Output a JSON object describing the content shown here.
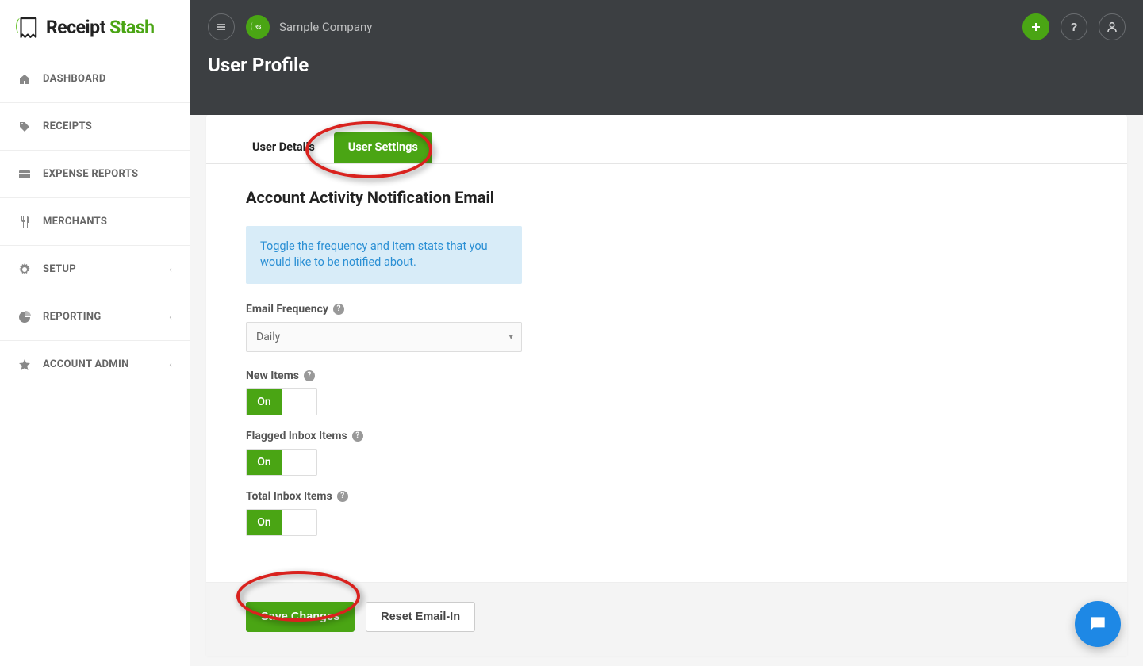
{
  "logo": {
    "brand": "Receipt",
    "accent": "Stash"
  },
  "sidebar": {
    "items": [
      {
        "label": "DASHBOARD",
        "icon": "home"
      },
      {
        "label": "RECEIPTS",
        "icon": "tag"
      },
      {
        "label": "EXPENSE REPORTS",
        "icon": "card"
      },
      {
        "label": "MERCHANTS",
        "icon": "fork"
      },
      {
        "label": "SETUP",
        "icon": "gear",
        "expandable": true
      },
      {
        "label": "REPORTING",
        "icon": "pie",
        "expandable": true
      },
      {
        "label": "ACCOUNT ADMIN",
        "icon": "star",
        "expandable": true
      }
    ]
  },
  "header": {
    "company": "Sample Company",
    "title": "User Profile"
  },
  "tabs": [
    {
      "label": "User Details",
      "active": false
    },
    {
      "label": "User Settings",
      "active": true
    }
  ],
  "section": {
    "title": "Account Activity Notification Email",
    "info": "Toggle the frequency and item stats that you would like to be notified about.",
    "fields": {
      "emailFrequency": {
        "label": "Email Frequency",
        "value": "Daily"
      },
      "newItems": {
        "label": "New Items",
        "value": "On"
      },
      "flagged": {
        "label": "Flagged Inbox Items",
        "value": "On"
      },
      "totalInbox": {
        "label": "Total Inbox Items",
        "value": "On"
      }
    }
  },
  "buttons": {
    "save": "Save Changes",
    "reset": "Reset Email-In"
  }
}
